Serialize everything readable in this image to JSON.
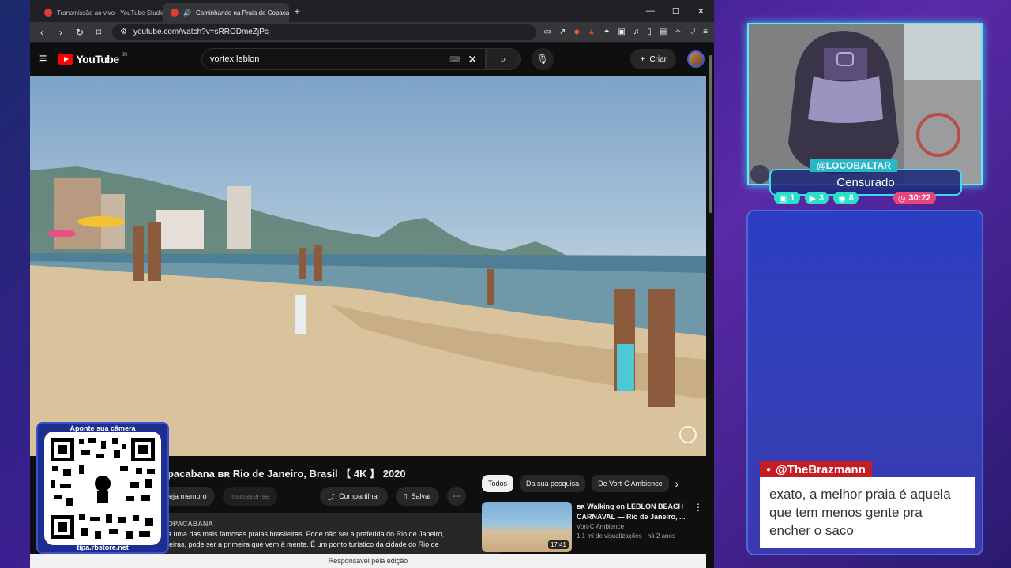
{
  "browser": {
    "tabs": [
      {
        "title": "Transmissão ao vivo - YouTube Studio"
      },
      {
        "title": "Caminhando na Praia de Copacabana"
      }
    ],
    "url": "youtube.com/watch?v=sRRODmeZjPc"
  },
  "youtube": {
    "logo_text": "YouTube",
    "region": "BR",
    "search_value": "vortex leblon",
    "create_label": "Criar",
    "video_title": "opacabana ʙʀ Rio de Janeiro, Brasil 【 4K 】 2020",
    "member_label": "eja membro",
    "subscribe_label": "Inscrever-se",
    "share_label": "Compartilhar",
    "save_label": "Salvar",
    "desc_channel": "OPACABANA",
    "desc_line1": "a uma das mais famosas praias brasileiras. Pode não ser a preferida do Rio de Janeiro,",
    "desc_line2": "leiras, pode ser a primeira que vem à mente. É um ponto turístico da cidade do Rio de",
    "chips": [
      "Todos",
      "Da sua pesquisa",
      "De Vort-C Ambience"
    ],
    "rec": {
      "title_line1": "ʙʀ Walking on LEBLON BEACH",
      "title_line2": "CARNAVAL — Rio de Janeiro, ...",
      "channel": "Vort-C Ambience",
      "meta": "1,1 mi de visualizações · há 2 anos",
      "duration": "17:41"
    },
    "status": "Responsável pela edição"
  },
  "qr": {
    "top_text": "Aponte sua câmera",
    "bottom_text": "tipa.rbstore.net"
  },
  "stream": {
    "name": "@LOCOBALTAR",
    "status": "Censurado",
    "stats": {
      "twitch": "1",
      "youtube": "3",
      "other": "8",
      "timer": "30:22"
    },
    "chat_user": "@TheBrazmann",
    "chat_message": "exato, a melhor praia é aquela que tem menos gente pra encher o saco"
  }
}
